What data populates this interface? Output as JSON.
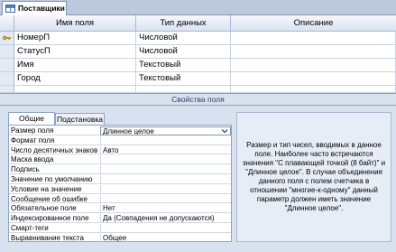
{
  "document": {
    "tab_label": "Поставщики"
  },
  "grid": {
    "columns": [
      "Имя поля",
      "Тип данных",
      "Описание"
    ],
    "rows": [
      {
        "name": "НомерП",
        "type": "Числовой",
        "description": "",
        "primary_key": true
      },
      {
        "name": "СтатусП",
        "type": "Числовой",
        "description": "",
        "primary_key": false
      },
      {
        "name": "Имя",
        "type": "Текстовый",
        "description": "",
        "primary_key": false
      },
      {
        "name": "Город",
        "type": "Текстовый",
        "description": "",
        "primary_key": false
      }
    ]
  },
  "properties": {
    "section_title": "Свойства поля",
    "tabs": [
      "Общие",
      "Подстановка"
    ],
    "active_tab": "Общие",
    "items": [
      {
        "label": "Размер поля",
        "value": "Длинное целое"
      },
      {
        "label": "Формат поля",
        "value": ""
      },
      {
        "label": "Число десятичных знаков",
        "value": "Авто"
      },
      {
        "label": "Маска ввода",
        "value": ""
      },
      {
        "label": "Подпись",
        "value": ""
      },
      {
        "label": "Значение по умолчанию",
        "value": ""
      },
      {
        "label": "Условие на значение",
        "value": ""
      },
      {
        "label": "Сообщение об ошибке",
        "value": ""
      },
      {
        "label": "Обязательное поле",
        "value": "Нет"
      },
      {
        "label": "Индексированное поле",
        "value": "Да (Совпадения не допускаются)"
      },
      {
        "label": "Смарт-теги",
        "value": ""
      },
      {
        "label": "Выравнивание текста",
        "value": "Общее"
      }
    ],
    "help_text": "Размер и тип чисел, вводимых в данное поле. Наиболее часто встречаются значения \"С плавающей точкой (8 байт)\" и \"Длинное целое\". В случае объединения данного поля с полем счетчика в отношении \"многие-к-одному\" данный параметр должен иметь значение \"Длинное целое\"."
  },
  "colors": {
    "background": "#bcc9dd",
    "panel": "#d8e1ee",
    "border": "#8ea2c2"
  }
}
